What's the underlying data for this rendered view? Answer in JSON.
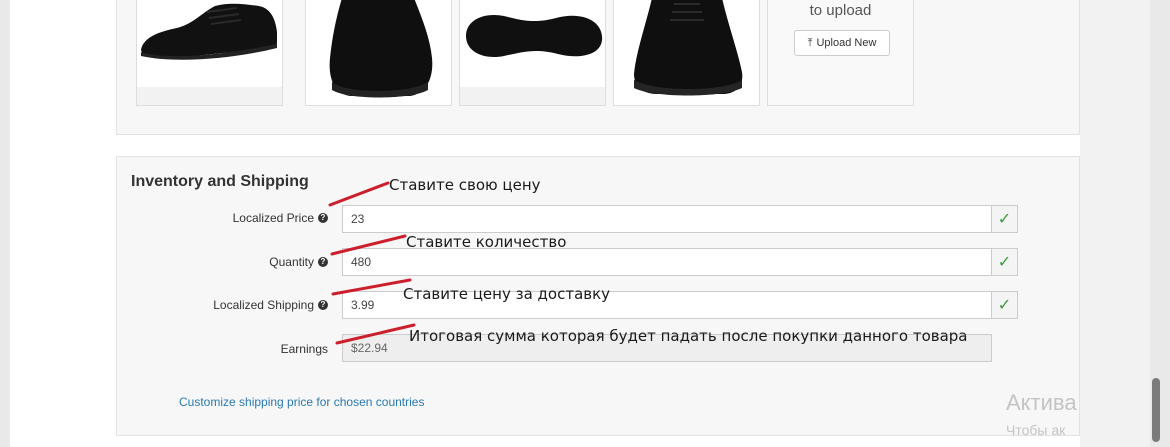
{
  "upload": {
    "text": "to upload",
    "button_label": "Upload New"
  },
  "inventory": {
    "title": "Inventory and Shipping",
    "fields": [
      {
        "label": "Localized Price",
        "value": "23"
      },
      {
        "label": "Quantity",
        "value": "480"
      },
      {
        "label": "Localized Shipping",
        "value": "3.99"
      },
      {
        "label": "Earnings",
        "value": "$22.94"
      }
    ],
    "customize_link": "Customize shipping price for chosen countries"
  },
  "annotations": {
    "price_note": "Ставите свою цену",
    "quantity_note": "Ставите количество",
    "shipping_note": "Ставите цену за доставку",
    "earnings_note": "Итоговая сумма которая будет падать после покупки данного товара"
  },
  "watermark": {
    "line1": "Актива",
    "line2": "Чтобы ак"
  },
  "colors": {
    "annotation_red": "#cc1f2b",
    "link_blue": "#2a7ab0",
    "check_green": "#3c9a3c"
  }
}
